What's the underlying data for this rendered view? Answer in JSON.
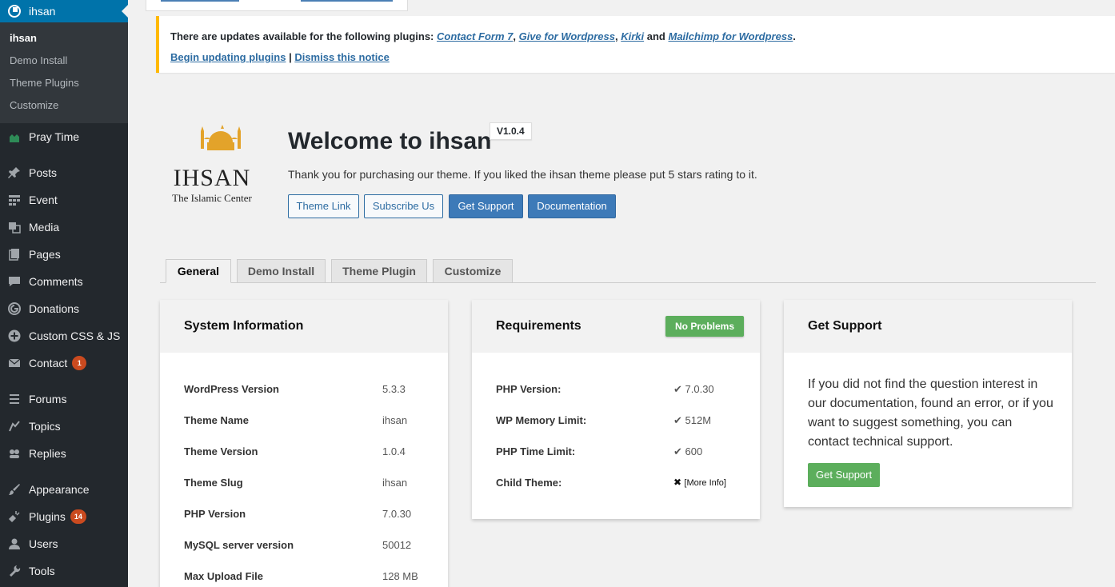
{
  "sidebar": {
    "current": "ihsan",
    "submenu": [
      "ihsan",
      "Demo Install",
      "Theme Plugins",
      "Customize"
    ],
    "items": [
      {
        "label": "Pray Time",
        "icon": "mosque-icon"
      },
      {
        "label": "Posts",
        "icon": "pin-icon"
      },
      {
        "label": "Event",
        "icon": "grid-icon"
      },
      {
        "label": "Media",
        "icon": "media-icon"
      },
      {
        "label": "Pages",
        "icon": "pages-icon"
      },
      {
        "label": "Comments",
        "icon": "comment-icon"
      },
      {
        "label": "Donations",
        "icon": "give-icon"
      },
      {
        "label": "Custom CSS & JS",
        "icon": "plus-icon"
      },
      {
        "label": "Contact",
        "icon": "mail-icon",
        "badge": "1"
      },
      {
        "label": "Forums",
        "icon": "forums-icon"
      },
      {
        "label": "Topics",
        "icon": "topics-icon"
      },
      {
        "label": "Replies",
        "icon": "replies-icon"
      },
      {
        "label": "Appearance",
        "icon": "brush-icon"
      },
      {
        "label": "Plugins",
        "icon": "plug-icon",
        "badge": "14"
      },
      {
        "label": "Users",
        "icon": "user-icon"
      },
      {
        "label": "Tools",
        "icon": "wrench-icon"
      }
    ]
  },
  "notice": {
    "prefix": "There are updates available for the following plugins: ",
    "plugins": [
      "Contact Form 7",
      "Give for Wordpress",
      "Kirki"
    ],
    "and": "and",
    "last_plugin": "Mailchimp for Wordpress",
    "begin_link": "Begin updating plugins",
    "separator": "|",
    "dismiss_link": "Dismiss this notice"
  },
  "logo": {
    "name": "IHSAN",
    "tagline": "The Islamic Center",
    "accent": "#e3a32a"
  },
  "welcome": {
    "title": "Welcome to ihsan",
    "version": "V1.0.4",
    "text": "Thank you for purchasing our theme. If you liked the ihsan theme please put 5 stars rating to it.",
    "buttons": [
      "Theme Link",
      "Subscribe Us",
      "Get Support",
      "Documentation"
    ]
  },
  "tabs": [
    "General",
    "Demo Install",
    "Theme Plugin",
    "Customize"
  ],
  "system_info": {
    "title": "System Information",
    "rows": [
      {
        "k": "WordPress Version",
        "v": "5.3.3"
      },
      {
        "k": "Theme Name",
        "v": "ihsan"
      },
      {
        "k": "Theme Version",
        "v": "1.0.4"
      },
      {
        "k": "Theme Slug",
        "v": "ihsan"
      },
      {
        "k": "PHP Version",
        "v": "7.0.30"
      },
      {
        "k": "MySQL server version",
        "v": "50012"
      },
      {
        "k": "Max Upload File",
        "v": "128 MB"
      }
    ]
  },
  "requirements": {
    "title": "Requirements",
    "status": "No Problems",
    "rows": [
      {
        "k": "PHP Version:",
        "v": "7.0.30",
        "ok": true
      },
      {
        "k": "WP Memory Limit:",
        "v": "512M",
        "ok": true
      },
      {
        "k": "PHP Time Limit:",
        "v": "600",
        "ok": true
      },
      {
        "k": "Child Theme:",
        "v": "[More Info]",
        "ok": false
      }
    ]
  },
  "support": {
    "title": "Get Support",
    "text": "If you did not find the question interest in our documentation, found an error, or if you want to suggest something, you can contact technical support.",
    "button": "Get Support"
  },
  "colors": {
    "sidebar_bg": "#23282d",
    "accent_blue": "#0073aa",
    "notice_border": "#ffb900",
    "ok_green": "#46a34b"
  }
}
